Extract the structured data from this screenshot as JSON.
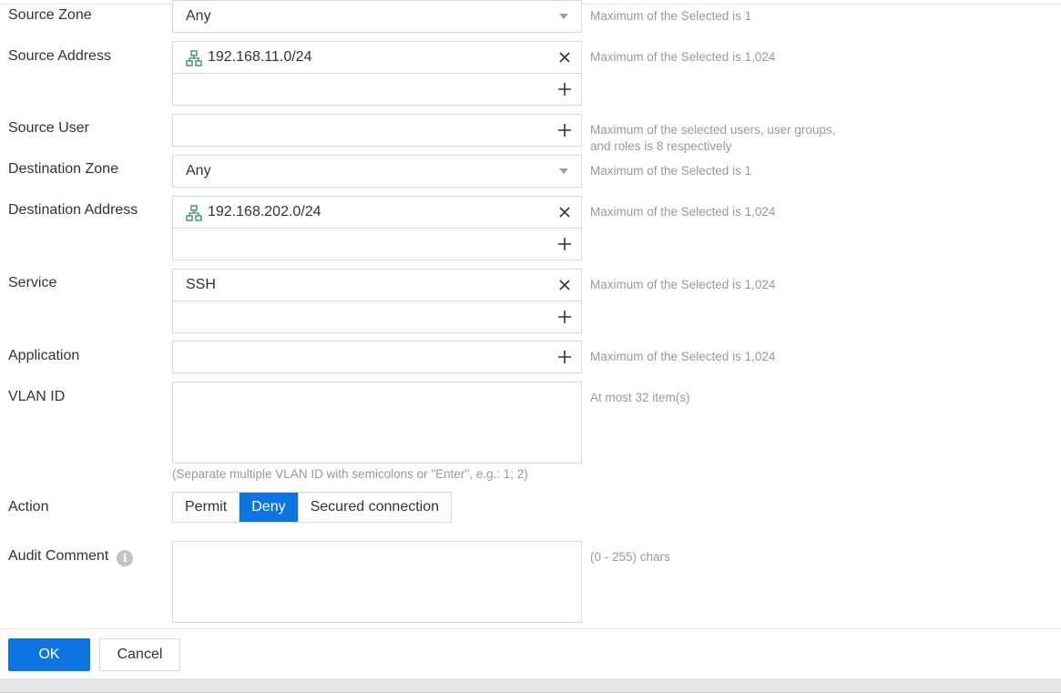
{
  "fields": {
    "source_zone": {
      "label": "Source Zone",
      "value": "Any",
      "hint": "Maximum of the Selected is 1"
    },
    "source_address": {
      "label": "Source Address",
      "items": [
        "192.168.11.0/24"
      ],
      "hint": "Maximum of the Selected is 1,024"
    },
    "source_user": {
      "label": "Source User",
      "hint_line1": "Maximum of the selected users, user groups,",
      "hint_line2": "and roles is 8 respectively"
    },
    "destination_zone": {
      "label": "Destination Zone",
      "value": "Any",
      "hint": "Maximum of the Selected is 1"
    },
    "destination_address": {
      "label": "Destination Address",
      "items": [
        "192.168.202.0/24"
      ],
      "hint": "Maximum of the Selected is 1,024"
    },
    "service": {
      "label": "Service",
      "items": [
        "SSH"
      ],
      "hint": "Maximum of the Selected is 1,024"
    },
    "application": {
      "label": "Application",
      "hint": "Maximum of the Selected is 1,024"
    },
    "vlan_id": {
      "label": "VLAN ID",
      "value": "",
      "hint": "At most 32 item(s)",
      "note": "(Separate multiple VLAN ID with semicolons or \"Enter\", e.g.: 1; 2)"
    },
    "action": {
      "label": "Action",
      "options": [
        "Permit",
        "Deny",
        "Secured connection"
      ],
      "selected": "Deny"
    },
    "audit_comment": {
      "label": "Audit Comment",
      "value": "",
      "hint": "(0 - 255) chars",
      "info_icon": "i"
    }
  },
  "icons": {
    "network": "network-object-icon",
    "remove": "close-icon",
    "add": "plus-icon",
    "dropdown": "caret-down-icon",
    "info": "info-icon"
  },
  "buttons": {
    "ok": "OK",
    "cancel": "Cancel"
  },
  "colors": {
    "primary": "#0e74df",
    "hint_text": "#999999",
    "border": "#d9d9d9",
    "network_icon": "#2e8b57"
  }
}
